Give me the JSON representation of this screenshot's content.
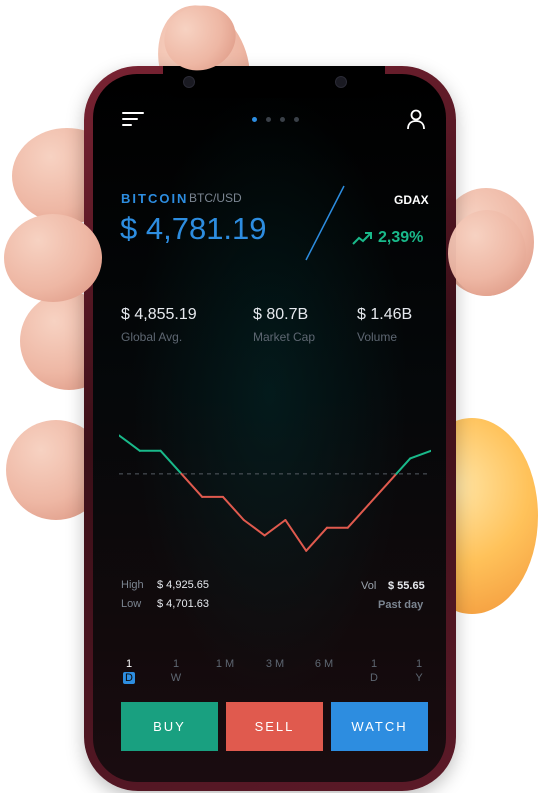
{
  "header": {
    "menu_icon": "menu-icon",
    "profile_icon": "user-icon",
    "pager": {
      "count": 4,
      "active_index": 0
    }
  },
  "ticker": {
    "coin_name": "BITCOIN",
    "pair": "BTC/USD",
    "price": "$ 4,781.19",
    "exchange": "GDAX",
    "change": "2,39%",
    "change_icon": "trend-up-icon"
  },
  "stats": [
    {
      "value": "$ 4,855.19",
      "label": "Global Avg."
    },
    {
      "value": "$ 80.7B",
      "label": "Market Cap"
    },
    {
      "value": "$ 1.46B",
      "label": "Volume"
    }
  ],
  "chart_data": {
    "type": "line",
    "x": [
      0,
      1,
      2,
      3,
      4,
      5,
      6,
      7,
      8,
      9,
      10,
      11,
      12,
      13,
      14,
      15
    ],
    "values": [
      4.0,
      3.6,
      3.6,
      3.0,
      2.4,
      2.4,
      1.8,
      1.4,
      1.8,
      1.0,
      1.6,
      1.6,
      2.2,
      2.8,
      3.4,
      3.6
    ],
    "baseline": 3.0,
    "colors": {
      "above": "#19b98a",
      "below": "#e05a4e",
      "baseline": "#555b63"
    }
  },
  "range": {
    "high_label": "High",
    "high_value": "$ 4,925.65",
    "low_label": "Low",
    "low_value": "$ 4,701.63",
    "vol_label": "Vol",
    "vol_value": "$ 55.65",
    "period": "Past day"
  },
  "timeframes": [
    {
      "num": "1",
      "unit": "D",
      "active": true
    },
    {
      "num": "1",
      "unit": "W",
      "active": false
    },
    {
      "num": "1 M",
      "unit": "",
      "active": false
    },
    {
      "num": "3 M",
      "unit": "",
      "active": false
    },
    {
      "num": "6 M",
      "unit": "",
      "active": false
    },
    {
      "num": "1",
      "unit": "D",
      "active": false
    },
    {
      "num": "1",
      "unit": "Y",
      "active": false
    }
  ],
  "actions": {
    "buy_label": "BUY",
    "sell_label": "SELL",
    "watch_label": "WATCH",
    "buy_color": "#19a080",
    "sell_color": "#e05a4e",
    "watch_color": "#2d8de0"
  }
}
